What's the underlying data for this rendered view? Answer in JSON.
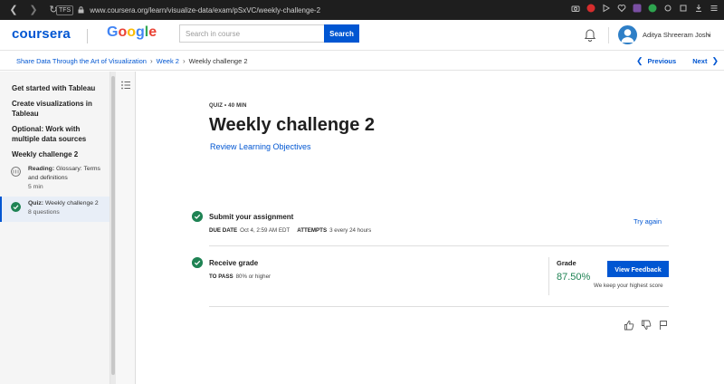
{
  "browser": {
    "url_badge": "TFS",
    "url": "www.coursera.org/learn/visualize-data/exam/pSxVC/weekly-challenge-2"
  },
  "header": {
    "logo": "coursera",
    "partner_letters": [
      "G",
      "o",
      "o",
      "g",
      "l",
      "e"
    ],
    "partner_colors": [
      "#4285f4",
      "#ea4335",
      "#fbbc05",
      "#4285f4",
      "#34a853",
      "#ea4335"
    ],
    "search_placeholder": "Search in course",
    "search_button": "Search",
    "user_name": "Aditya Shreeram Joshi"
  },
  "breadcrumb": {
    "items": [
      "Share Data Through the Art of Visualization",
      "Week 2"
    ],
    "current": "Weekly challenge 2",
    "previous": "Previous",
    "next": "Next"
  },
  "sidebar": {
    "headings": [
      "Get started with Tableau",
      "Create visualizations in Tableau",
      "Optional: Work with multiple data sources",
      "Weekly challenge 2"
    ],
    "items": [
      {
        "type": "Reading:",
        "title": "Glossary: Terms and definitions",
        "sub": "5 min",
        "icon": "reading-icon",
        "active": false
      },
      {
        "type": "Quiz:",
        "title": "Weekly challenge 2",
        "sub": "8 questions",
        "icon": "completed-check-icon",
        "active": true
      }
    ]
  },
  "main": {
    "meta": "QUIZ • 40 MIN",
    "title": "Weekly challenge 2",
    "objectives_link": "Review Learning Objectives",
    "submit": {
      "title": "Submit your assignment",
      "due_label": "DUE DATE",
      "due_value": "Oct 4, 2:59 AM EDT",
      "attempts_label": "ATTEMPTS",
      "attempts_value": "3 every 24 hours",
      "action": "Try again"
    },
    "grade": {
      "title": "Receive grade",
      "pass_label": "TO PASS",
      "pass_value": "80% or higher",
      "grade_label": "Grade",
      "grade_value": "87.50%",
      "feedback_button": "View Feedback",
      "note": "We keep your highest score"
    }
  },
  "colors": {
    "accent": "#0056d2",
    "success": "#1f8354"
  }
}
